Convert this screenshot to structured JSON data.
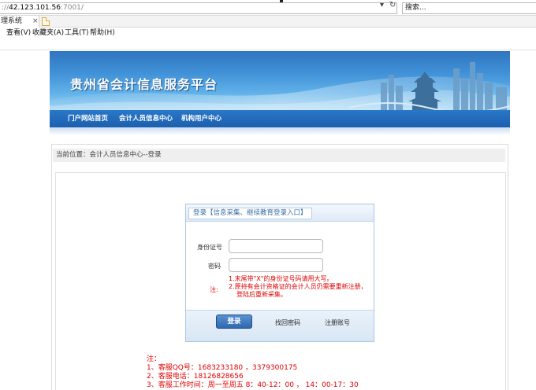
{
  "browser": {
    "address_prefix": "://",
    "address_host": "42.123.101.56",
    "address_suffix": ":7001/",
    "search_placeholder": "搜索...",
    "refresh_glyph": "↻",
    "dropdown_glyph": "▾",
    "tab_title": "理系统",
    "tab_close_glyph": "×",
    "menu": [
      "查看(V)",
      "收藏夹(A)",
      "工具(T)",
      "帮助(H)"
    ]
  },
  "site": {
    "title": "贵州省会计信息服务平台",
    "nav": [
      "门户网站首页",
      "会计人员信息中心",
      "机构用户中心"
    ],
    "breadcrumb": "当前位置：会计人员信息中心--登录"
  },
  "login": {
    "title": "登录【信息采集、继续教育登录入口】",
    "id_label": "身份证号",
    "id_value": "",
    "password_label": "密码",
    "password_value": "",
    "note_label": "注:",
    "notes": [
      "1.末尾带\"X\"的身份证号码请用大写。",
      "2.原持有会计资格证的会计人员仍需要重新注册，",
      "登陆后重新采集。"
    ],
    "login_button": "登录",
    "find_password": "找回密码",
    "register": "注册账号"
  },
  "bottom_notes": {
    "label": "注：",
    "lines": [
      "1、客服QQ号：1683233180 ，3379300175",
      "2、客服电话：18126828656",
      "3、客服工作时间：周一至周五 8：40-12：00 ， 14：00-17：30"
    ]
  },
  "colors": {
    "nav_blue": "#1c5fae",
    "note_red": "#e00000",
    "login_border": "#a9c6e2"
  }
}
